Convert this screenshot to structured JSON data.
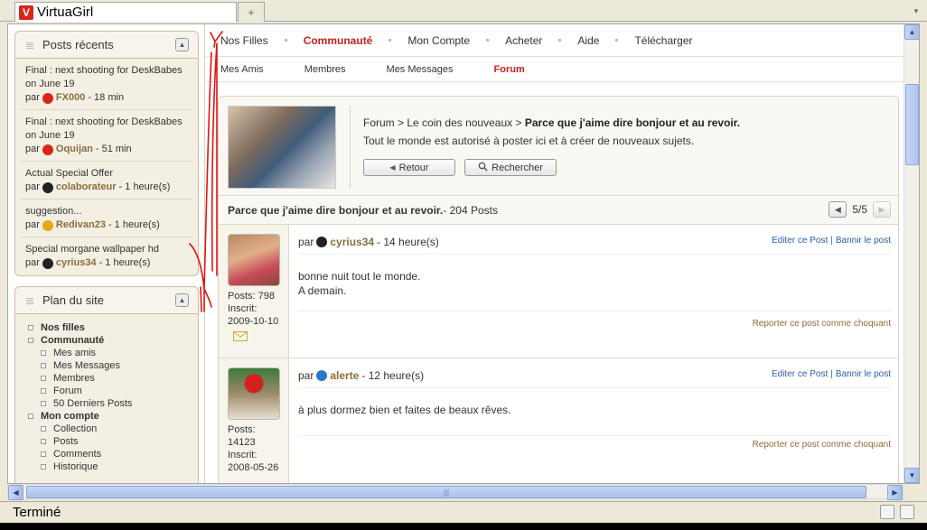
{
  "browser": {
    "tab_title": "VirtuaGirl",
    "logo_letter": "V",
    "new_tab_symbol": "+",
    "tab_list_symbol": "▾",
    "status_text": "Terminé"
  },
  "sidebar": {
    "recent_posts_title": "Posts récents",
    "collapse_symbol": "▲",
    "recent_posts": [
      {
        "title": "Final : next shooting for DeskBabes on June 19",
        "by": "par",
        "user": "FX000",
        "badge": "red",
        "time": " - 18 min"
      },
      {
        "title": "Final : next shooting for DeskBabes on June 19",
        "by": "par",
        "user": "Oquijan",
        "badge": "red",
        "time": " - 51 min"
      },
      {
        "title": "Actual Special Offer",
        "by": "par",
        "user": "colaborateur",
        "badge": "black",
        "time": " - 1 heure(s)"
      },
      {
        "title": "suggestion...",
        "by": "par",
        "user": "Redivan23",
        "badge": "gold",
        "time": " - 1 heure(s)"
      },
      {
        "title": "Special morgane wallpaper hd",
        "by": "par",
        "user": "cyrius34",
        "badge": "black",
        "time": " - 1 heure(s)"
      }
    ],
    "sitemap_title": "Plan du site",
    "sitemap": [
      {
        "label": "Nos filles",
        "level": 1
      },
      {
        "label": "Communauté",
        "level": 1
      },
      {
        "label": "Mes amis",
        "level": 2
      },
      {
        "label": "Mes Messages",
        "level": 2
      },
      {
        "label": "Membres",
        "level": 2
      },
      {
        "label": "Forum",
        "level": 2
      },
      {
        "label": "50 Derniers Posts",
        "level": 2
      },
      {
        "label": "Mon compte",
        "level": 1
      },
      {
        "label": "Collection",
        "level": 2
      },
      {
        "label": "Posts",
        "level": 2
      },
      {
        "label": "Comments",
        "level": 2
      },
      {
        "label": "Historique",
        "level": 2
      }
    ]
  },
  "nav": {
    "main": [
      "Nos Filles",
      "Communauté",
      "Mon Compte",
      "Acheter",
      "Aide",
      "Télécharger"
    ],
    "main_active": "Communauté",
    "sub": [
      "Mes Amis",
      "Membres",
      "Mes Messages",
      "Forum"
    ],
    "sub_active": "Forum"
  },
  "header": {
    "crumb_forum": "Forum",
    "crumb_sep": " > ",
    "crumb_section": "Le coin des nouveaux",
    "crumb_topic": "Parce que j'aime dire bonjour et au revoir.",
    "info": "Tout le monde est autorisé à poster ici et à créer de nouveaux sujets.",
    "back_label": "Retour",
    "search_label": "Rechercher"
  },
  "thread": {
    "title": "Parce que j'aime dire bonjour et au revoir.",
    "count": " - 204 Posts",
    "page": "5/5"
  },
  "posts": [
    {
      "by": "par",
      "user": "cyrius34",
      "badge": "black",
      "time": " - 14 heure(s)",
      "edit": "Editer ce Post",
      "ban": "Bannir le post",
      "line1": "bonne nuit tout le monde.",
      "line2": "A demain.",
      "report": "Reporter ce post comme choquant",
      "posts_label": "Posts: 798",
      "joined_label": "Inscrit:",
      "joined": "2009-10-10"
    },
    {
      "by": "par",
      "user": "alerte",
      "badge": "blue",
      "time": " - 12 heure(s)",
      "edit": "Editer ce Post",
      "ban": "Bannir le post",
      "line1": "à plus dormez bien et faites de beaux rêves.",
      "line2": "",
      "report": "Reporter ce post comme choquant",
      "posts_label": "Posts:",
      "posts_count": "14123",
      "joined_label": "Inscrit:",
      "joined": "2008-05-26"
    }
  ],
  "colors": {
    "accent_red": "#c81e1e",
    "username_brown": "#8a6d3b",
    "link_blue": "#2a5db0",
    "scrollbar_blue": "#a5bde9"
  }
}
